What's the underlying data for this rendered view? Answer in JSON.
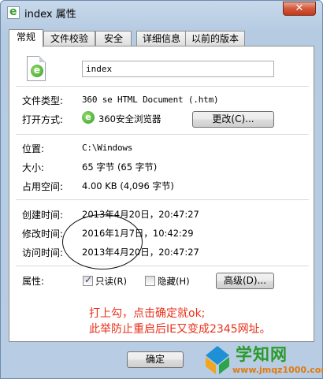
{
  "window": {
    "title": "index 属性",
    "close_glyph": "✕"
  },
  "tabs": [
    {
      "label": "常规"
    },
    {
      "label": "文件校验"
    },
    {
      "label": "安全"
    },
    {
      "label": "详细信息"
    },
    {
      "label": "以前的版本"
    }
  ],
  "file": {
    "name": "index"
  },
  "props": {
    "type_label": "文件类型:",
    "type_value": "360 se HTML Document (.htm)",
    "open_label": "打开方式:",
    "open_value": "360安全浏览器",
    "change_button": "更改(C)...",
    "location_label": "位置:",
    "location_value": "C:\\Windows",
    "size_label": "大小:",
    "size_value": "65 字节 (65 字节)",
    "disk_label": "占用空间:",
    "disk_value": "4.00 KB (4,096 字节)",
    "created_label": "创建时间:",
    "created_value": "2013年4月20日，20:47:27",
    "modified_label": "修改时间:",
    "modified_value": "2016年1月7日，10:42:29",
    "accessed_label": "访问时间:",
    "accessed_value": "2013年4月20日，20:47:27",
    "attr_label": "属性:",
    "readonly_label": "只读(R)",
    "readonly_checked": true,
    "hidden_label": "隐藏(H)",
    "hidden_checked": false,
    "advanced_button": "高级(D)..."
  },
  "annotation": {
    "line1": "打上勾，点击确定就ok;",
    "line2": "此举防止重启后IE又变成2345网址。"
  },
  "footer": {
    "ok_button": "确定"
  },
  "watermark": {
    "title": "学知网",
    "url": "www.jmqz1000.com"
  },
  "colors": {
    "annotation": "#e8301a",
    "watermark_green": "#2a9a2a",
    "watermark_orange": "#e07a10"
  }
}
